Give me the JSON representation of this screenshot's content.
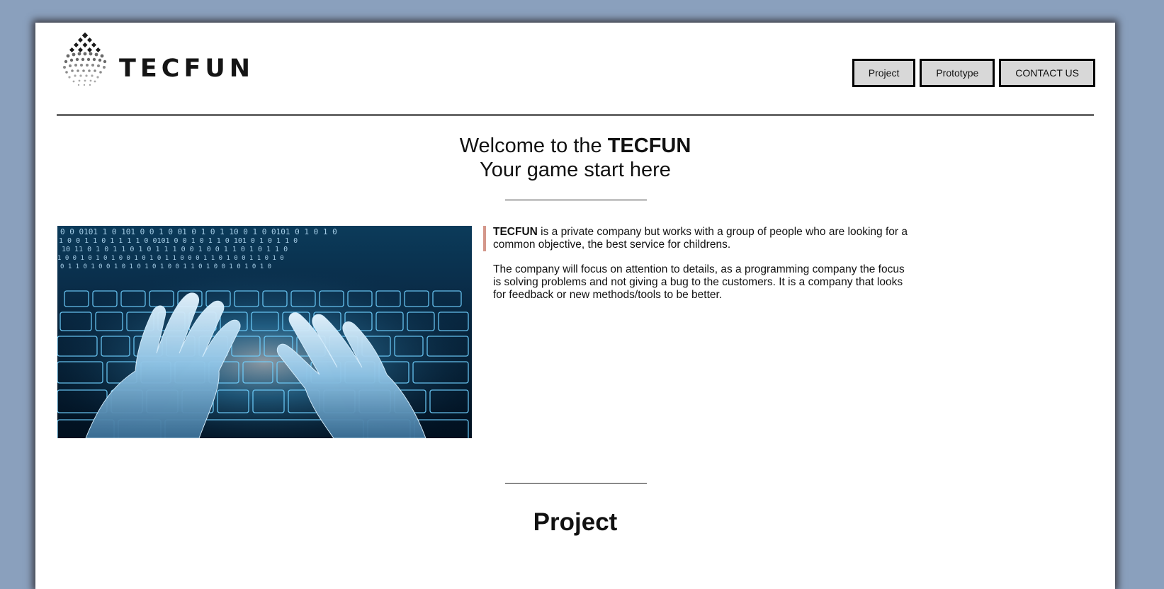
{
  "brand": {
    "name": "TECFUN",
    "logo_icon": "diamond-dots-logo-icon"
  },
  "nav": {
    "items": [
      {
        "label": "Project"
      },
      {
        "label": "Prototype"
      },
      {
        "label": "CONTACT US"
      }
    ]
  },
  "welcome": {
    "line1_prefix": "Welcome to the ",
    "line1_brand": "TECFUN",
    "line2": "Your game start here"
  },
  "hero_image": {
    "subject": "hands typing on glowing blue keyboard with binary code"
  },
  "about": {
    "p1_brand": "TECFUN",
    "p1_text": " is a private company but works with a group of people who are looking for a common objective, the best service for childrens.",
    "p2_text": "The company will focus on attention to details, as a programming company the focus is solving problems and not giving a bug to the customers. It is a company that looks for feedback or new methods/tools to be better."
  },
  "sections": {
    "project_title": "Project"
  },
  "colors": {
    "page_background": "#8aa0bd",
    "content_background": "#ffffff",
    "button_background": "#d8d8d8",
    "quote_accent": "#d4978b"
  }
}
